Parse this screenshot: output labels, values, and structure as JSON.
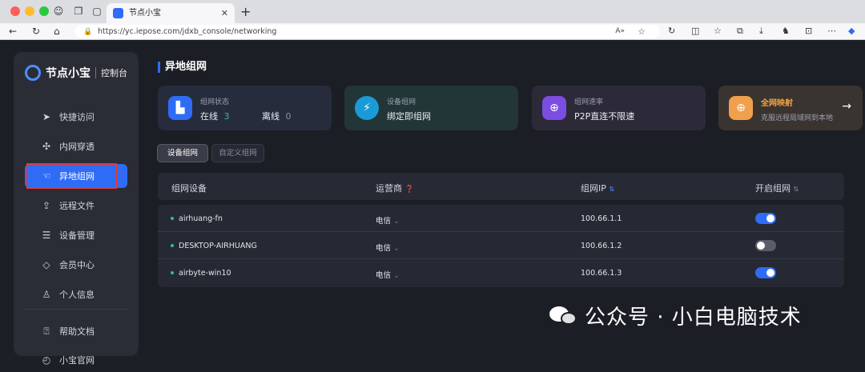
{
  "browser": {
    "tab_title": "节点小宝",
    "url": "https://yc.iepose.com/jdxb_console/networking"
  },
  "sidebar": {
    "logo_text": "节点小宝",
    "logo_sub": "控制台",
    "items": [
      {
        "label": "快捷访问",
        "icon": "send-icon"
      },
      {
        "label": "内网穿透",
        "icon": "fan-icon"
      },
      {
        "label": "异地组网",
        "icon": "hand-icon",
        "active": true
      },
      {
        "label": "远程文件",
        "icon": "upload-icon"
      },
      {
        "label": "设备管理",
        "icon": "server-icon"
      },
      {
        "label": "会员中心",
        "icon": "diamond-icon"
      },
      {
        "label": "个人信息",
        "icon": "user-icon"
      },
      {
        "label": "帮助文档",
        "icon": "help-icon"
      },
      {
        "label": "小宝官网",
        "icon": "globe-icon"
      }
    ]
  },
  "main": {
    "title": "异地组网",
    "cards": [
      {
        "label": "组网状态",
        "online_label": "在线",
        "online_count": "3",
        "offline_label": "离线",
        "offline_count": "0",
        "icon_color": "#2f6cf6"
      },
      {
        "label": "设备组网",
        "value": "绑定即组网",
        "icon_color": "#1a9bd7"
      },
      {
        "label": "组网速率",
        "value": "P2P直连不限速",
        "icon_color": "#7b4de1"
      },
      {
        "label": "全网映射",
        "value": "克服远程局域网到本地",
        "icon_color": "#f0a04b",
        "highlight": "#f5a545"
      }
    ],
    "tabs": [
      "设备组网",
      "自定义组网"
    ],
    "table": {
      "headers": [
        "组网设备",
        "运营商",
        "组网IP",
        "开启组网"
      ],
      "rows": [
        {
          "device": "airhuang-fn",
          "carrier": "电信",
          "ip": "100.66.1.1",
          "enabled": true
        },
        {
          "device": "DESKTOP-AIRHUANG",
          "carrier": "电信",
          "ip": "100.66.1.2",
          "enabled": false
        },
        {
          "device": "airbyte-win10",
          "carrier": "电信",
          "ip": "100.66.1.3",
          "enabled": true
        }
      ]
    }
  },
  "watermark": "公众号 · 小白电脑技术",
  "colors": {
    "accent": "#2f6cf6",
    "online": "#2bc48a",
    "toggle_on": "#2f6cf6",
    "toggle_off": "#5a5d68"
  }
}
